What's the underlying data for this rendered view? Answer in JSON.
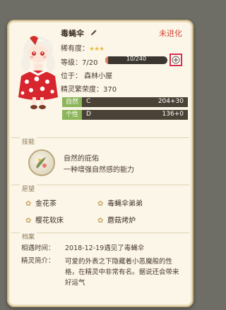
{
  "header": {
    "name": "毒蝇伞",
    "evolution_status": "未进化"
  },
  "stats": {
    "rarity_label": "稀有度：",
    "rarity_stars": "★★★",
    "level_label": "等级：7/20",
    "exp_text": "10/240",
    "exp_progress": 0.042,
    "location": "位于：  森林小屋",
    "prosperity": "精灵繁荣度：370"
  },
  "attributes": [
    {
      "tag": "自然",
      "grade": "C",
      "value": "204+30",
      "tag_color": "#8db55a"
    },
    {
      "tag": "个性",
      "grade": "D",
      "value": "136+0",
      "tag_color": "#8db55a"
    }
  ],
  "skills": {
    "title": "技能",
    "name": "自然的庇佑",
    "desc": "一种增强自然感的能力"
  },
  "wishes": {
    "title": "愿望",
    "items": [
      "金花茶",
      "毒蝇伞弟弟",
      "樱花软床",
      "蘑菇烤炉"
    ]
  },
  "archive": {
    "title": "档案",
    "meet_label": "相遇时间：",
    "meet_value": "2018-12-19遇见了毒蝇伞",
    "intro_label": "精灵简介：",
    "intro_value": "可爱的外表之下隐藏着小恶魔般的性格，在精灵中非常有名。据说还会带来好运气"
  },
  "colors": {
    "accent_red": "#d24a3a",
    "highlight_box": "#d43048",
    "exp_fill": "#e07f5a"
  }
}
